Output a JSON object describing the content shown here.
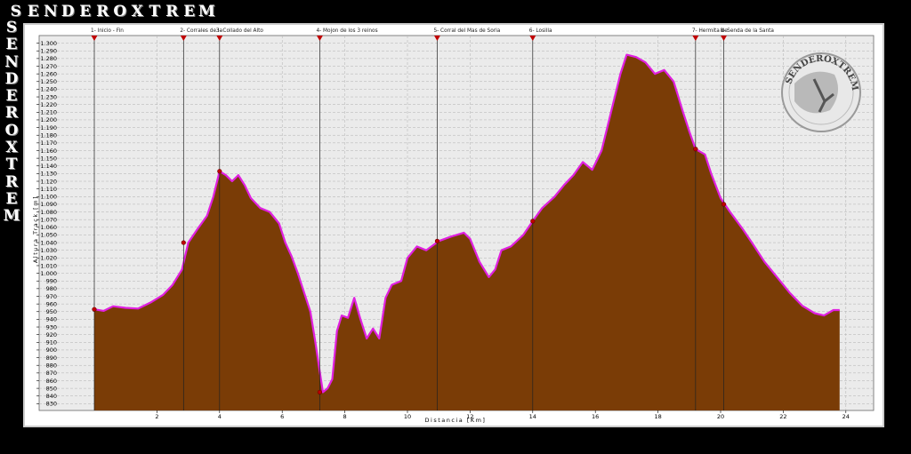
{
  "brand": {
    "letters": [
      "S",
      "E",
      "N",
      "D",
      "E",
      "R",
      "O",
      "X",
      "T",
      "R",
      "E",
      "M"
    ]
  },
  "logo": {
    "text": "SENDEROXTREM"
  },
  "colors": {
    "fill": "#7a3c06",
    "stroke": "#e020e0",
    "grid": "#b0b0b0",
    "plotbg": "#ebebeb"
  },
  "chart_data": {
    "type": "area",
    "xlabel": "Distancia [Km]",
    "ylabel": "Altura Track [m]",
    "xlim": [
      0,
      25
    ],
    "ylim": [
      820,
      1305
    ],
    "xticks": [
      2,
      4,
      6,
      8,
      10,
      12,
      14,
      16,
      18,
      20,
      22,
      24
    ],
    "yticks": [
      830,
      840,
      850,
      860,
      870,
      880,
      890,
      900,
      910,
      920,
      930,
      940,
      950,
      960,
      970,
      980,
      990,
      1000,
      1010,
      1020,
      1030,
      1040,
      1050,
      1060,
      1070,
      1080,
      1090,
      1100,
      1110,
      1120,
      1130,
      1140,
      1150,
      1160,
      1170,
      1180,
      1190,
      1200,
      1210,
      1220,
      1230,
      1240,
      1250,
      1260,
      1270,
      1280,
      1290,
      1300
    ],
    "ytick_labels": [
      "830",
      "840",
      "850",
      "860",
      "870",
      "880",
      "890",
      "900",
      "910",
      "920",
      "930",
      "940",
      "950",
      "960",
      "970",
      "980",
      "990",
      "1.000",
      "1.010",
      "1.020",
      "1.030",
      "1.040",
      "1.050",
      "1.060",
      "1.070",
      "1.080",
      "1.090",
      "1.100",
      "1.110",
      "1.120",
      "1.130",
      "1.140",
      "1.150",
      "1.160",
      "1.170",
      "1.180",
      "1.190",
      "1.200",
      "1.210",
      "1.220",
      "1.230",
      "1.240",
      "1.250",
      "1.260",
      "1.270",
      "1.280",
      "1.290",
      "1.300"
    ],
    "profile": [
      [
        0.0,
        953
      ],
      [
        0.3,
        951
      ],
      [
        0.6,
        957
      ],
      [
        1.0,
        955
      ],
      [
        1.4,
        954
      ],
      [
        1.8,
        962
      ],
      [
        2.2,
        972
      ],
      [
        2.5,
        985
      ],
      [
        2.8,
        1005
      ],
      [
        3.0,
        1040
      ],
      [
        3.3,
        1058
      ],
      [
        3.6,
        1075
      ],
      [
        3.8,
        1100
      ],
      [
        4.0,
        1133
      ],
      [
        4.2,
        1128
      ],
      [
        4.4,
        1120
      ],
      [
        4.6,
        1128
      ],
      [
        4.8,
        1115
      ],
      [
        5.0,
        1098
      ],
      [
        5.3,
        1085
      ],
      [
        5.6,
        1080
      ],
      [
        5.9,
        1065
      ],
      [
        6.1,
        1040
      ],
      [
        6.3,
        1022
      ],
      [
        6.5,
        1000
      ],
      [
        6.7,
        975
      ],
      [
        6.9,
        950
      ],
      [
        7.05,
        912
      ],
      [
        7.2,
        872
      ],
      [
        7.3,
        845
      ],
      [
        7.45,
        850
      ],
      [
        7.6,
        862
      ],
      [
        7.75,
        925
      ],
      [
        7.9,
        945
      ],
      [
        8.1,
        942
      ],
      [
        8.3,
        968
      ],
      [
        8.5,
        940
      ],
      [
        8.7,
        915
      ],
      [
        8.9,
        928
      ],
      [
        9.1,
        915
      ],
      [
        9.3,
        968
      ],
      [
        9.5,
        985
      ],
      [
        9.8,
        990
      ],
      [
        10.0,
        1020
      ],
      [
        10.3,
        1035
      ],
      [
        10.6,
        1030
      ],
      [
        11.0,
        1042
      ],
      [
        11.4,
        1048
      ],
      [
        11.8,
        1053
      ],
      [
        12.0,
        1045
      ],
      [
        12.3,
        1015
      ],
      [
        12.6,
        995
      ],
      [
        12.8,
        1005
      ],
      [
        13.0,
        1030
      ],
      [
        13.3,
        1035
      ],
      [
        13.7,
        1050
      ],
      [
        14.0,
        1068
      ],
      [
        14.3,
        1085
      ],
      [
        14.7,
        1100
      ],
      [
        15.0,
        1115
      ],
      [
        15.3,
        1128
      ],
      [
        15.6,
        1145
      ],
      [
        15.9,
        1135
      ],
      [
        16.2,
        1160
      ],
      [
        16.5,
        1210
      ],
      [
        16.8,
        1260
      ],
      [
        17.0,
        1285
      ],
      [
        17.3,
        1282
      ],
      [
        17.6,
        1275
      ],
      [
        17.9,
        1260
      ],
      [
        18.2,
        1265
      ],
      [
        18.5,
        1250
      ],
      [
        18.8,
        1210
      ],
      [
        19.0,
        1185
      ],
      [
        19.2,
        1162
      ],
      [
        19.5,
        1155
      ],
      [
        19.7,
        1130
      ],
      [
        20.0,
        1098
      ],
      [
        20.3,
        1080
      ],
      [
        20.7,
        1058
      ],
      [
        21.0,
        1040
      ],
      [
        21.4,
        1015
      ],
      [
        21.8,
        995
      ],
      [
        22.2,
        975
      ],
      [
        22.6,
        958
      ],
      [
        23.0,
        948
      ],
      [
        23.3,
        945
      ],
      [
        23.6,
        952
      ],
      [
        23.8,
        952
      ]
    ],
    "waypoints": [
      {
        "label": "1- Inicio - Fin",
        "km": 0.0,
        "alt": 953
      },
      {
        "label": "2- Corrales de la",
        "km": 2.85,
        "alt": 1040
      },
      {
        "label": "3- Collado del Alto",
        "km": 4.0,
        "alt": 1133
      },
      {
        "label": "4- Mojon de los 3 reinos",
        "km": 7.2,
        "alt": 845
      },
      {
        "label": "5- Corral del Mas de Soria",
        "km": 10.95,
        "alt": 1042
      },
      {
        "label": "6- Losilla",
        "km": 14.0,
        "alt": 1068
      },
      {
        "label": "7- Hermita de",
        "km": 19.2,
        "alt": 1162
      },
      {
        "label": "8- Senda de la Santa",
        "km": 20.1,
        "alt": 1090
      }
    ]
  }
}
